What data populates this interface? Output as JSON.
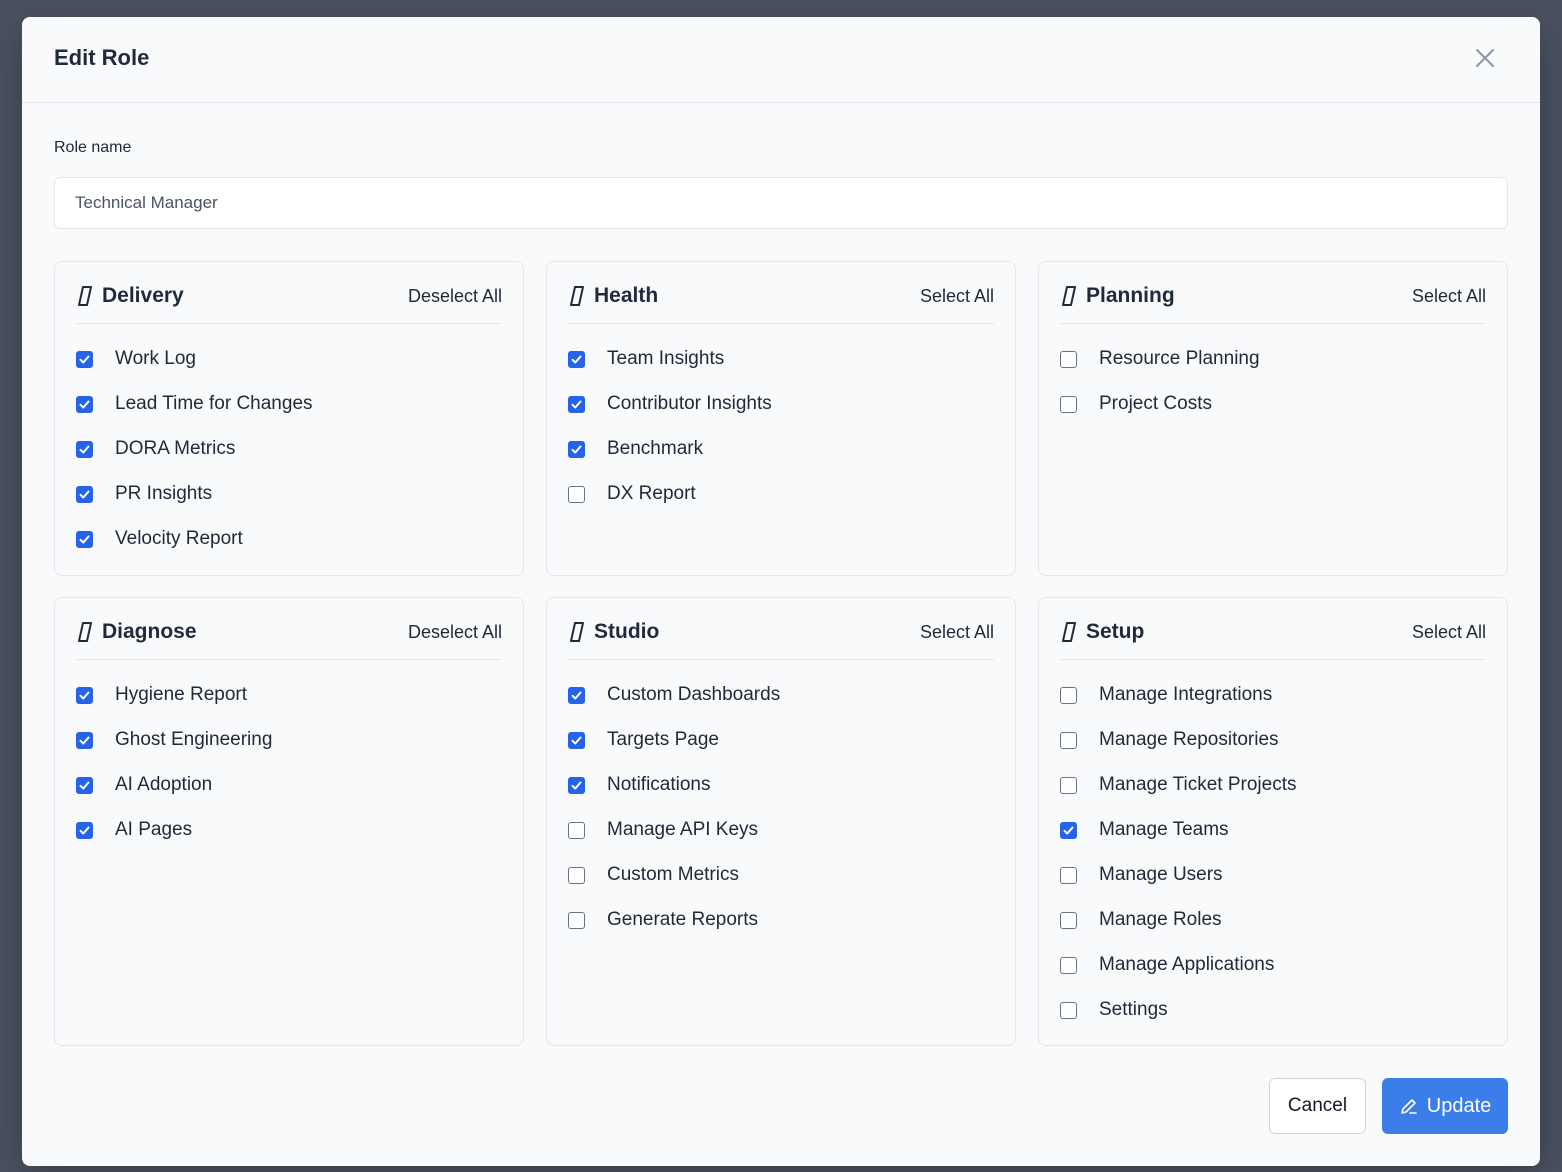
{
  "modal": {
    "title": "Edit Role",
    "role_label": "Role name",
    "role_value": "Technical Manager"
  },
  "cards": [
    {
      "title": "Delivery",
      "action": "Deselect All",
      "items": [
        {
          "label": "Work Log",
          "checked": true
        },
        {
          "label": "Lead Time for Changes",
          "checked": true
        },
        {
          "label": "DORA Metrics",
          "checked": true
        },
        {
          "label": "PR Insights",
          "checked": true
        },
        {
          "label": "Velocity Report",
          "checked": true
        }
      ]
    },
    {
      "title": "Health",
      "action": "Select All",
      "items": [
        {
          "label": "Team Insights",
          "checked": true
        },
        {
          "label": "Contributor Insights",
          "checked": true
        },
        {
          "label": "Benchmark",
          "checked": true
        },
        {
          "label": "DX Report",
          "checked": false
        }
      ]
    },
    {
      "title": "Planning",
      "action": "Select All",
      "items": [
        {
          "label": "Resource Planning",
          "checked": false
        },
        {
          "label": "Project Costs",
          "checked": false
        }
      ]
    },
    {
      "title": "Diagnose",
      "action": "Deselect All",
      "items": [
        {
          "label": "Hygiene Report",
          "checked": true
        },
        {
          "label": "Ghost Engineering",
          "checked": true
        },
        {
          "label": "AI Adoption",
          "checked": true
        },
        {
          "label": "AI Pages",
          "checked": true
        }
      ]
    },
    {
      "title": "Studio",
      "action": "Select All",
      "items": [
        {
          "label": "Custom Dashboards",
          "checked": true
        },
        {
          "label": "Targets Page",
          "checked": true
        },
        {
          "label": "Notifications",
          "checked": true
        },
        {
          "label": "Manage API Keys",
          "checked": false
        },
        {
          "label": "Custom Metrics",
          "checked": false
        },
        {
          "label": "Generate Reports",
          "checked": false
        }
      ]
    },
    {
      "title": "Setup",
      "action": "Select All",
      "items": [
        {
          "label": "Manage Integrations",
          "checked": false
        },
        {
          "label": "Manage Repositories",
          "checked": false
        },
        {
          "label": "Manage Ticket Projects",
          "checked": false
        },
        {
          "label": "Manage Teams",
          "checked": true
        },
        {
          "label": "Manage Users",
          "checked": false
        },
        {
          "label": "Manage Roles",
          "checked": false
        },
        {
          "label": "Manage Applications",
          "checked": false
        },
        {
          "label": "Settings",
          "checked": false
        }
      ]
    }
  ],
  "footer": {
    "cancel_label": "Cancel",
    "update_label": "Update"
  },
  "colors": {
    "accent": "#3b7de9",
    "checkbox_checked": "#2563eb",
    "overlay": "#4a5260"
  },
  "icons": {
    "close": "close-icon",
    "category": "slash-icon",
    "update": "pencil-icon"
  }
}
